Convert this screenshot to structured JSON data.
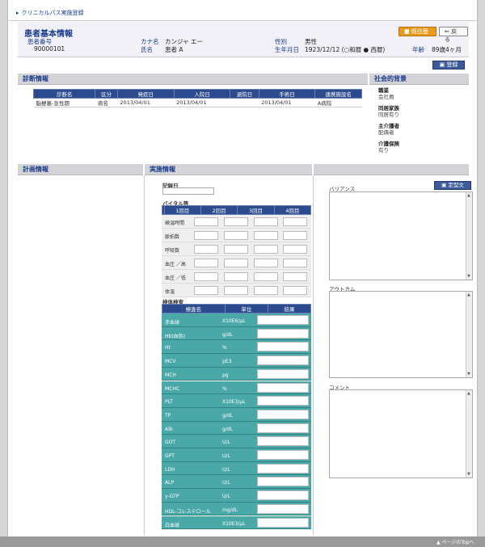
{
  "breadcrumb": "クリニカルパス実施登録",
  "patient": {
    "title": "患者基本情報",
    "id_label": "患者番号",
    "id_value": "90000101",
    "kana_label": "カナ名",
    "kana_value": "カンジャ エー",
    "name_label": "氏名",
    "name_value": "患者 A",
    "sex_label": "性別",
    "sex_value": "男性",
    "dob_label": "生年月日",
    "dob_value": "1923/12/12 (○和暦 ● 西暦)",
    "age_label": "年齢",
    "age_value": "89歳4ヶ月",
    "history_button": "既往歴",
    "back_button": "戻る"
  },
  "register_button": "登録",
  "diagnosis": {
    "header": "診断情報",
    "columns": [
      "診断名",
      "区分",
      "発症日",
      "入院日",
      "退院日",
      "手術日",
      "連携施設名"
    ],
    "rows": [
      [
        "脳梗塞-急性期",
        "病名",
        "2013/04/01",
        "2013/04/01",
        "",
        "2013/04/01",
        "A病院"
      ]
    ]
  },
  "social": {
    "header": "社会的背景",
    "items": [
      {
        "k": "職業",
        "v": "会社員"
      },
      {
        "k": "同居家族",
        "v": "同居有り"
      },
      {
        "k": "主介護者",
        "v": "配偶者"
      },
      {
        "k": "介護保険",
        "v": "有り"
      }
    ]
  },
  "plan": {
    "header": "計画情報"
  },
  "exec": {
    "header": "実施情報",
    "date_label": "記録日",
    "vital_title": "バイタル等",
    "vital_cols": [
      "",
      "1回目",
      "2回目",
      "3回目",
      "4回目"
    ],
    "vital_rows": [
      "検温時間",
      "脈拍数",
      "呼吸数",
      "血圧 ／高",
      "血圧 ／低",
      "体温"
    ],
    "lab_title": "検体検査",
    "lab_cols": [
      "検査名",
      "単位",
      "結果"
    ],
    "lab_rows": [
      [
        "赤血球",
        "X10E6/μL"
      ],
      [
        "Hb(血色)",
        "g/dL"
      ],
      [
        "Ht",
        "%"
      ],
      [
        "MCV",
        "pE3"
      ],
      [
        "MCH",
        "pg"
      ],
      [
        "MCHC",
        "%"
      ],
      [
        "PLT",
        "X10E3/μL"
      ],
      [
        "TP",
        "g/dL"
      ],
      [
        "Alb",
        "g/dL"
      ],
      [
        "GOT",
        "U/L"
      ],
      [
        "GPT",
        "U/L"
      ],
      [
        "LDH",
        "U/L"
      ],
      [
        "ALP",
        "U/L"
      ],
      [
        "γ-GTP",
        "U/L"
      ],
      [
        "HDL-コレステロール",
        "mg/dL"
      ],
      [
        "白血球",
        "X10E3/μL"
      ]
    ]
  },
  "right": {
    "variance": "バリアンス",
    "template_button": "定型文",
    "outcome": "アウトカム",
    "comment": "コメント"
  },
  "page_top": "▲ ページのTopへ"
}
